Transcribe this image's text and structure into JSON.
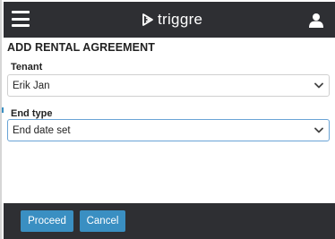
{
  "header": {
    "brand_name": "triggre",
    "menu_icon": "hamburger-menu-icon",
    "logo_icon": "triggre-logo-icon",
    "user_icon": "user-icon",
    "background_color": "#2e2f33"
  },
  "form": {
    "title": "ADD RENTAL AGREEMENT",
    "tenant": {
      "label": "Tenant",
      "value": "Erik Jan"
    },
    "end_type": {
      "label": "End type",
      "value": "End date set"
    }
  },
  "footer": {
    "proceed_label": "Proceed",
    "cancel_label": "Cancel",
    "button_color": "#3a8fc2",
    "background_color": "#2e2f33"
  }
}
